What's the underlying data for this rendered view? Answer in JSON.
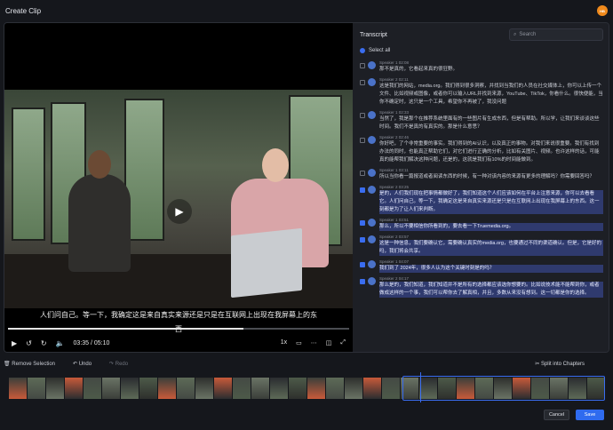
{
  "header": {
    "title": "Create Clip",
    "avatar_initials": "HB"
  },
  "video": {
    "subtitle": "人们问自己。等一下，我确定这是来自真实来源还是只是在互联网上出现在我屏幕上的东西",
    "time": "03:35 / 05:10",
    "speed": "1x",
    "progress_fraction": 0.69
  },
  "transcript": {
    "label": "Transcript",
    "search_placeholder": "Search",
    "select_all": "Select all",
    "entries": [
      {
        "meta": "Speaker 1  02:08",
        "text": "那不是真的，它看起来真的很狂野。",
        "selected": false
      },
      {
        "meta": "Speaker 2  02:11",
        "text": "这是我们的网站，media.org。我们得到很多洞察，并找到当我们的人员在社交媒体上，你可以上传一个文件、比如视频或图像，或者你可以输入URL并找到来源，YouTube、TikTok，你看什么。很快便能，当你不确定时，这只是一个工具，希望你不再被了，我没问题",
        "selected": false
      },
      {
        "meta": "Speaker 1  02:33",
        "text": "当然了，我是那个在推荐系统里面有的一些图片有生成东西，但是有帮助。所以学，让我们来谈谈这些时间。我们不是真的有真实的。那是什么意思？",
        "selected": false
      },
      {
        "meta": "Speaker 2  02:46",
        "text": "你好吧，了个非常重要的事实。我们得到的AI认识，以及真正的事物。对我们来说很重要。我们有找到办法的同时，也能真正帮助它们，对它们进行正确的分析，比如有关图片、视频。也许这样的话，可能真的能帮我们解决这种问题，还是的，这就是我们有10%的时间能做到。",
        "selected": false
      },
      {
        "meta": "Speaker 1  03:11",
        "text": "所以当你看一篇报道或者阅读东西的时候，有一种对该内容的来源有更多的理解吗？你需要回答吗？",
        "selected": false
      },
      {
        "meta": "Speaker 2  03:25",
        "text": "是的，人们我们现在把事情都做好了，我们知道这个人们应该如何在平台上注意来源，你可以去看看它。人们问自己。等一下，我确定这是来自真实来源还是只是在互联网上出现在我屏幕上的东西。这一刻都是为了让人们来判断。",
        "selected": true
      },
      {
        "meta": "Speaker 1  03:51",
        "text": "那么，所以不要相信你所看到的，要去看一下Truemedia.org。",
        "selected": true
      },
      {
        "meta": "Speaker 2  03:57",
        "text": "这是一种信息，我们要确认它，需要确认真实的media.org，也要通过不同的渠道确认。但是，它是好的吗，我们将会共享。",
        "selected": true
      },
      {
        "meta": "Speaker 1  04:07",
        "text": "我们到了 2024年，很多人认为这个关键时刻是的吗？",
        "selected": true
      },
      {
        "meta": "Speaker 2  04:17",
        "text": "那么是的，我们知道，我们知道并不是所有的选择都应该选你想要的。比如说技术能不能帮到你，或者做成这样的一个事，我们可以帮你去了解真相，并且，多数从来没有想到。这一切都是你的选择。",
        "selected": true
      }
    ]
  },
  "bottom": {
    "remove_selection": "Remove Selection",
    "undo": "Undo",
    "redo": "Redo",
    "split_chapters": "Split into Chapters",
    "cancel": "Cancel",
    "save": "Save"
  },
  "colors": {
    "accent": "#2f6bef",
    "avatar": "#f08a1c"
  }
}
